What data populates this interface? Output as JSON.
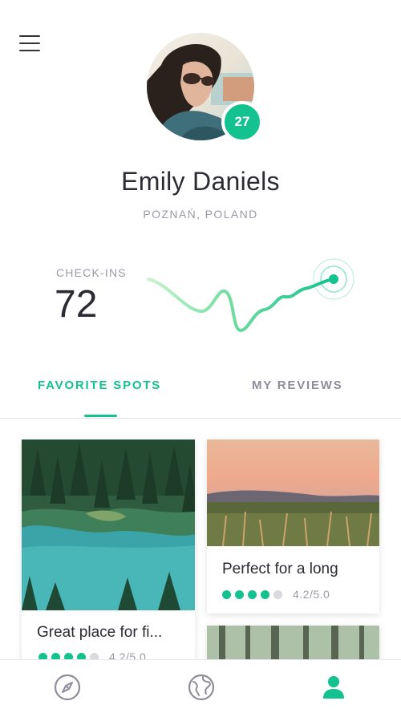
{
  "header": {
    "menu_icon": "hamburger-menu-icon"
  },
  "profile": {
    "name": "Emily Daniels",
    "location": "POZNAŃ, POLAND",
    "badge_count": "27"
  },
  "stats": {
    "checkins_label": "CHECK-INS",
    "checkins_value": "72"
  },
  "tabs": [
    {
      "label": "FAVORITE SPOTS",
      "active": true
    },
    {
      "label": "MY REVIEWS",
      "active": false
    }
  ],
  "cards": [
    {
      "title": "Great place for fi...",
      "rating_filled": 4,
      "rating_total": 5,
      "rating_text": "4.2/5.0"
    },
    {
      "title": "Perfect for a long",
      "rating_filled": 4,
      "rating_total": 5,
      "rating_text": "4.2/5.0"
    }
  ],
  "bottom_nav": [
    {
      "icon": "compass-icon",
      "active": false
    },
    {
      "icon": "globe-icon",
      "active": false
    },
    {
      "icon": "user-icon",
      "active": true
    }
  ],
  "colors": {
    "accent": "#13c28e",
    "text_dark": "#2b2b33",
    "text_muted": "#9a9aa6"
  }
}
